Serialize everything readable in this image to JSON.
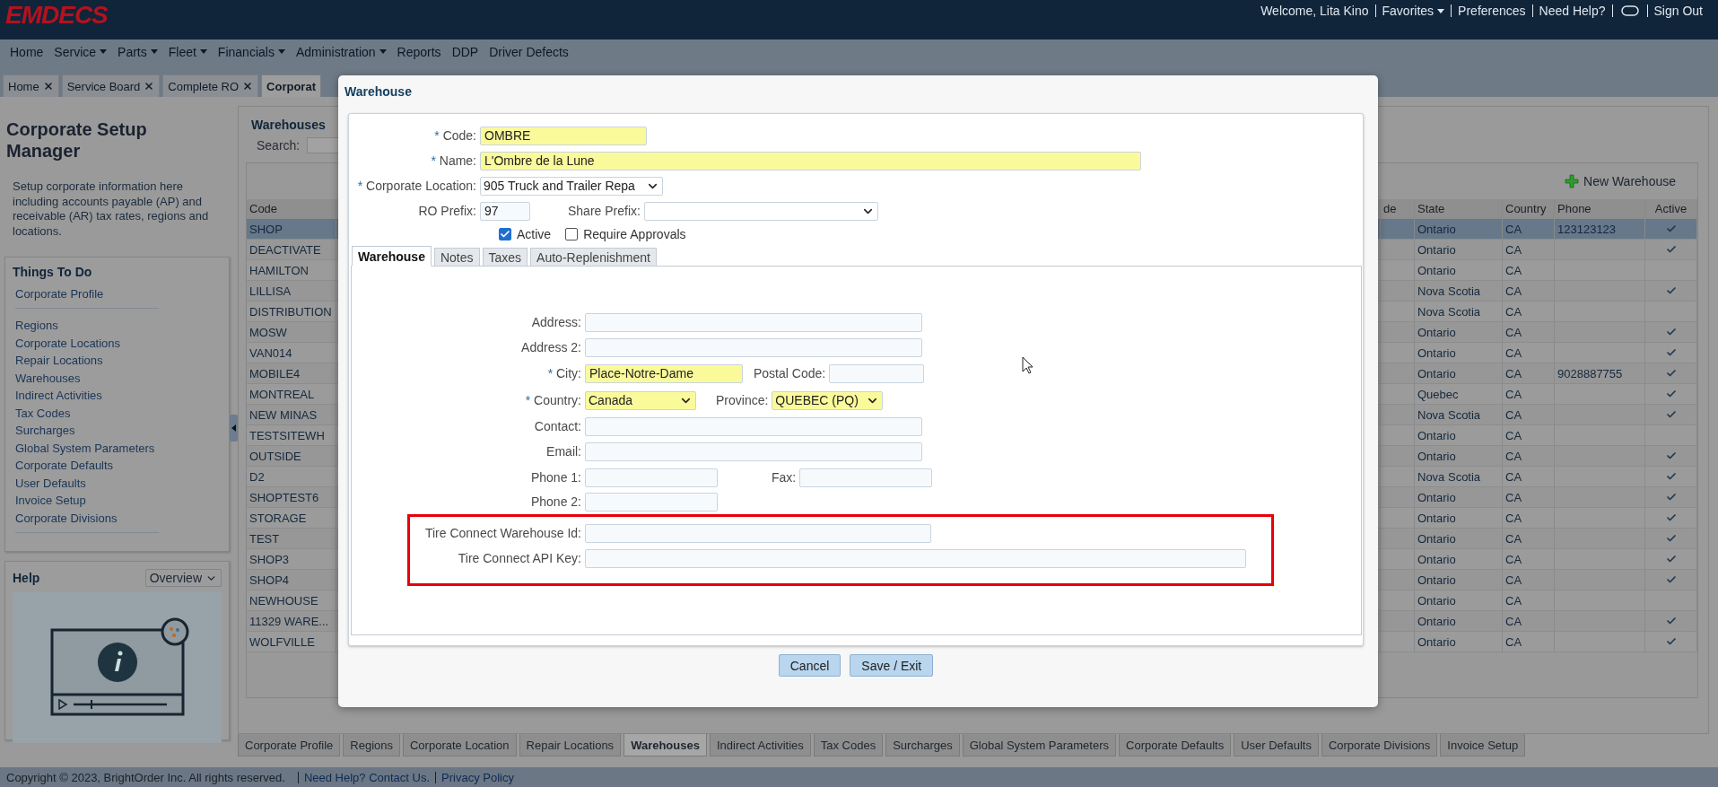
{
  "header": {
    "logo": "EMDECS",
    "welcome": "Welcome, Lita Kino",
    "links": [
      {
        "kind": "link",
        "label": "Favorites",
        "has_menu": true
      },
      {
        "kind": "link",
        "label": "Preferences",
        "has_menu": false
      },
      {
        "kind": "link",
        "label": "Need Help?",
        "has_menu": false
      },
      {
        "kind": "toggle"
      },
      {
        "kind": "link",
        "label": "Sign Out",
        "has_menu": false
      }
    ]
  },
  "menu": [
    {
      "label": "Home",
      "has_menu": false
    },
    {
      "label": "Service",
      "has_menu": true
    },
    {
      "label": "Parts",
      "has_menu": true
    },
    {
      "label": "Fleet",
      "has_menu": true
    },
    {
      "label": "Financials",
      "has_menu": true
    },
    {
      "label": "Administration",
      "has_menu": true
    },
    {
      "label": "Reports",
      "has_menu": false
    },
    {
      "label": "DDP",
      "has_menu": false
    },
    {
      "label": "Driver Defects",
      "has_menu": false
    }
  ],
  "open_tabs": [
    {
      "label": "Home",
      "selected": false
    },
    {
      "label": "Service Board",
      "selected": false
    },
    {
      "label": "Complete RO",
      "selected": false
    },
    {
      "label": "Corporat",
      "selected": true
    }
  ],
  "sidebar": {
    "title": "Corporate Setup Manager",
    "description": "Setup corporate information here including accounts payable (AP) and receivable (AR) tax rates, regions and locations.",
    "todo": {
      "title": "Things To Do",
      "groups": [
        [
          "Corporate Profile"
        ],
        [
          "Regions",
          "Corporate Locations",
          "Repair Locations",
          "Warehouses",
          "Indirect Activities",
          "Tax Codes",
          "Surcharges",
          "Global System Parameters",
          "Corporate Defaults",
          "User Defaults",
          "Invoice Setup",
          "Corporate Divisions"
        ]
      ]
    },
    "help": {
      "title": "Help",
      "select": "Overview"
    }
  },
  "main": {
    "title": "Warehouses",
    "search_label": "Search:",
    "new_button": "New Warehouse",
    "table": {
      "columns": [
        "Code",
        "de",
        "State",
        "Country",
        "Phone",
        "Active"
      ],
      "rows": [
        {
          "code": "SHOP",
          "state": "Ontario",
          "country": "CA",
          "phone": "123123123",
          "active": true,
          "selected": true
        },
        {
          "code": "DEACTIVATE",
          "state": "Ontario",
          "country": "CA",
          "active": true,
          "selected": false
        },
        {
          "code": "HAMILTON",
          "state": "Ontario",
          "country": "CA",
          "active": false,
          "selected": false
        },
        {
          "code": "LILLISA",
          "state": "Nova Scotia",
          "country": "CA",
          "active": true,
          "selected": false
        },
        {
          "code": "DISTRIBUTION",
          "state": "Nova Scotia",
          "country": "CA",
          "active": false,
          "selected": false
        },
        {
          "code": "MOSW",
          "state": "Ontario",
          "country": "CA",
          "active": true,
          "selected": false
        },
        {
          "code": "VAN014",
          "state": "Ontario",
          "country": "CA",
          "active": true,
          "selected": false
        },
        {
          "code": "MOBILE4",
          "state": "Ontario",
          "country": "CA",
          "phone": "9028887755",
          "active": true,
          "selected": false
        },
        {
          "code": "MONTREAL",
          "state": "Quebec",
          "country": "CA",
          "active": true,
          "selected": false
        },
        {
          "code": "NEW MINAS",
          "state": "Nova Scotia",
          "country": "CA",
          "active": true,
          "selected": false
        },
        {
          "code": "TESTSITEWH",
          "state": "Ontario",
          "country": "CA",
          "active": false,
          "selected": false
        },
        {
          "code": "OUTSIDE",
          "state": "Ontario",
          "country": "CA",
          "active": true,
          "selected": false
        },
        {
          "code": "D2",
          "state": "Nova Scotia",
          "country": "CA",
          "active": true,
          "selected": false
        },
        {
          "code": "SHOPTEST6",
          "state": "Ontario",
          "country": "CA",
          "active": true,
          "selected": false
        },
        {
          "code": "STORAGE",
          "state": "Ontario",
          "country": "CA",
          "active": true,
          "selected": false
        },
        {
          "code": "TEST",
          "state": "Ontario",
          "country": "CA",
          "active": true,
          "selected": false
        },
        {
          "code": "SHOP3",
          "state": "Ontario",
          "country": "CA",
          "active": true,
          "selected": false
        },
        {
          "code": "SHOP4",
          "state": "Ontario",
          "country": "CA",
          "active": true,
          "selected": false
        },
        {
          "code": "NEWHOUSE",
          "state": "Ontario",
          "country": "CA",
          "active": false,
          "selected": false
        },
        {
          "code": "11329 WARE...",
          "state": "Ontario",
          "country": "CA",
          "active": true,
          "selected": false
        },
        {
          "code": "WOLFVILLE",
          "state": "Ontario",
          "country": "CA",
          "active": true,
          "selected": false
        }
      ]
    }
  },
  "bottom_tabs": [
    {
      "label": "Corporate Profile",
      "selected": false
    },
    {
      "label": "Regions",
      "selected": false
    },
    {
      "label": "Corporate Location",
      "selected": false
    },
    {
      "label": "Repair Locations",
      "selected": false
    },
    {
      "label": "Warehouses",
      "selected": true
    },
    {
      "label": "Indirect Activities",
      "selected": false
    },
    {
      "label": "Tax Codes",
      "selected": false
    },
    {
      "label": "Surcharges",
      "selected": false
    },
    {
      "label": "Global System Parameters",
      "selected": false
    },
    {
      "label": "Corporate Defaults",
      "selected": false
    },
    {
      "label": "User Defaults",
      "selected": false
    },
    {
      "label": "Corporate Divisions",
      "selected": false
    },
    {
      "label": "Invoice Setup",
      "selected": false
    }
  ],
  "footer": {
    "copyright": "Copyright © 2023, BrightOrder Inc. All rights reserved.",
    "links": [
      "Need Help? Contact Us.",
      "Privacy Policy"
    ]
  },
  "dialog": {
    "title": "Warehouse",
    "code": {
      "label": "Code:",
      "marker": "*",
      "kind": "text",
      "value": "OMBRE",
      "highlighted": true
    },
    "name": {
      "label": "Name:",
      "marker": "*",
      "kind": "text",
      "value": "L'Ombre de la Lune",
      "highlighted": true
    },
    "corporate_location": {
      "label": "Corporate Location:",
      "marker": "*",
      "kind": "select",
      "value": "905 Truck and Trailer Repa",
      "highlighted": false
    },
    "ro_prefix": {
      "label": "RO Prefix:",
      "kind": "text",
      "value": "97",
      "highlighted": false
    },
    "share_prefix": {
      "label": "Share Prefix:",
      "kind": "select",
      "highlighted": false
    },
    "active": {
      "label": "Active",
      "checked": true
    },
    "require_approvals": {
      "label": "Require Approvals",
      "checked": false
    },
    "tabs": [
      {
        "label": "Warehouse",
        "selected": true
      },
      {
        "label": "Notes",
        "selected": false
      },
      {
        "label": "Taxes",
        "selected": false
      },
      {
        "label": "Auto-Replenishment",
        "selected": false
      }
    ],
    "address": {
      "label": "Address:",
      "kind": "text",
      "highlighted": false
    },
    "address_2": {
      "label": "Address 2:",
      "kind": "text",
      "highlighted": false
    },
    "city": {
      "label": "City:",
      "marker": "*",
      "kind": "text",
      "value": "Place-Notre-Dame",
      "highlighted": true
    },
    "postal_code": {
      "label": "Postal Code:",
      "kind": "text",
      "highlighted": false
    },
    "country": {
      "label": "Country:",
      "marker": "*",
      "kind": "select",
      "value": "Canada",
      "highlighted": true
    },
    "province": {
      "label": "Province:",
      "kind": "select",
      "value": "QUEBEC (PQ)",
      "highlighted": true
    },
    "contact": {
      "label": "Contact:",
      "kind": "text",
      "highlighted": false
    },
    "email": {
      "label": "Email:",
      "kind": "text",
      "highlighted": false
    },
    "phone_1": {
      "label": "Phone 1:",
      "kind": "text",
      "highlighted": false
    },
    "fax": {
      "label": "Fax:",
      "kind": "text",
      "highlighted": false
    },
    "phone_2": {
      "label": "Phone 2:",
      "kind": "text",
      "highlighted": false
    },
    "tire_connect": {
      "outlined": true,
      "fields": [
        {
          "label": "Tire Connect Warehouse Id:",
          "kind": "text",
          "highlighted": false
        },
        {
          "label": "Tire Connect API Key:",
          "kind": "text",
          "highlighted": false
        }
      ]
    },
    "buttons": [
      "Cancel",
      "Save / Exit"
    ]
  }
}
